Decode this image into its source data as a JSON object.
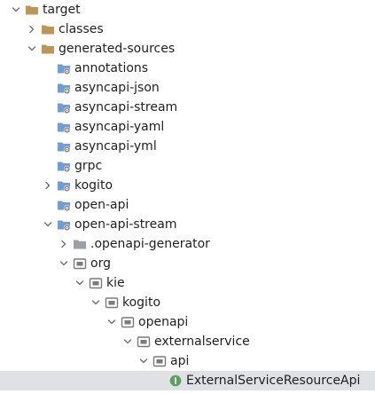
{
  "tree": {
    "nodes": [
      {
        "label": "target",
        "icon": "folder-icon",
        "chevron": "expanded",
        "depth": 0,
        "color": "#c09553"
      },
      {
        "label": "classes",
        "icon": "folder-icon",
        "chevron": "collapsed",
        "depth": 1,
        "color": "#c09553"
      },
      {
        "label": "generated-sources",
        "icon": "folder-icon",
        "chevron": "expanded",
        "depth": 1,
        "color": "#c09553"
      },
      {
        "label": "annotations",
        "icon": "generated-source-folder-icon",
        "chevron": "none",
        "depth": 2
      },
      {
        "label": "asyncapi-json",
        "icon": "generated-source-folder-icon",
        "chevron": "none",
        "depth": 2
      },
      {
        "label": "asyncapi-stream",
        "icon": "generated-source-folder-icon",
        "chevron": "none",
        "depth": 2
      },
      {
        "label": "asyncapi-yaml",
        "icon": "generated-source-folder-icon",
        "chevron": "none",
        "depth": 2
      },
      {
        "label": "asyncapi-yml",
        "icon": "generated-source-folder-icon",
        "chevron": "none",
        "depth": 2
      },
      {
        "label": "grpc",
        "icon": "generated-source-folder-icon",
        "chevron": "none",
        "depth": 2
      },
      {
        "label": "kogito",
        "icon": "generated-source-folder-icon",
        "chevron": "collapsed",
        "depth": 2
      },
      {
        "label": "open-api",
        "icon": "generated-source-folder-icon",
        "chevron": "none",
        "depth": 2
      },
      {
        "label": "open-api-stream",
        "icon": "generated-source-folder-icon",
        "chevron": "expanded",
        "depth": 2
      },
      {
        "label": ".openapi-generator",
        "icon": "gray-folder-icon",
        "chevron": "collapsed",
        "depth": 3
      },
      {
        "label": "org",
        "icon": "package-icon",
        "chevron": "expanded",
        "depth": 3
      },
      {
        "label": "kie",
        "icon": "package-icon",
        "chevron": "expanded",
        "depth": 4
      },
      {
        "label": "kogito",
        "icon": "package-icon",
        "chevron": "expanded",
        "depth": 5
      },
      {
        "label": "openapi",
        "icon": "package-icon",
        "chevron": "expanded",
        "depth": 6
      },
      {
        "label": "externalservice",
        "icon": "package-icon",
        "chevron": "expanded",
        "depth": 7
      },
      {
        "label": "api",
        "icon": "package-icon",
        "chevron": "expanded",
        "depth": 8
      },
      {
        "label": "ExternalServiceResourceApi",
        "icon": "interface-icon",
        "chevron": "none",
        "depth": 9,
        "selected": true
      }
    ]
  },
  "colors": {
    "folder": "#c09553",
    "source_folder": "#6e9ed8",
    "package": "#7a7a7a",
    "interface": "#5aa35a",
    "selection": "#dfe1e5"
  }
}
